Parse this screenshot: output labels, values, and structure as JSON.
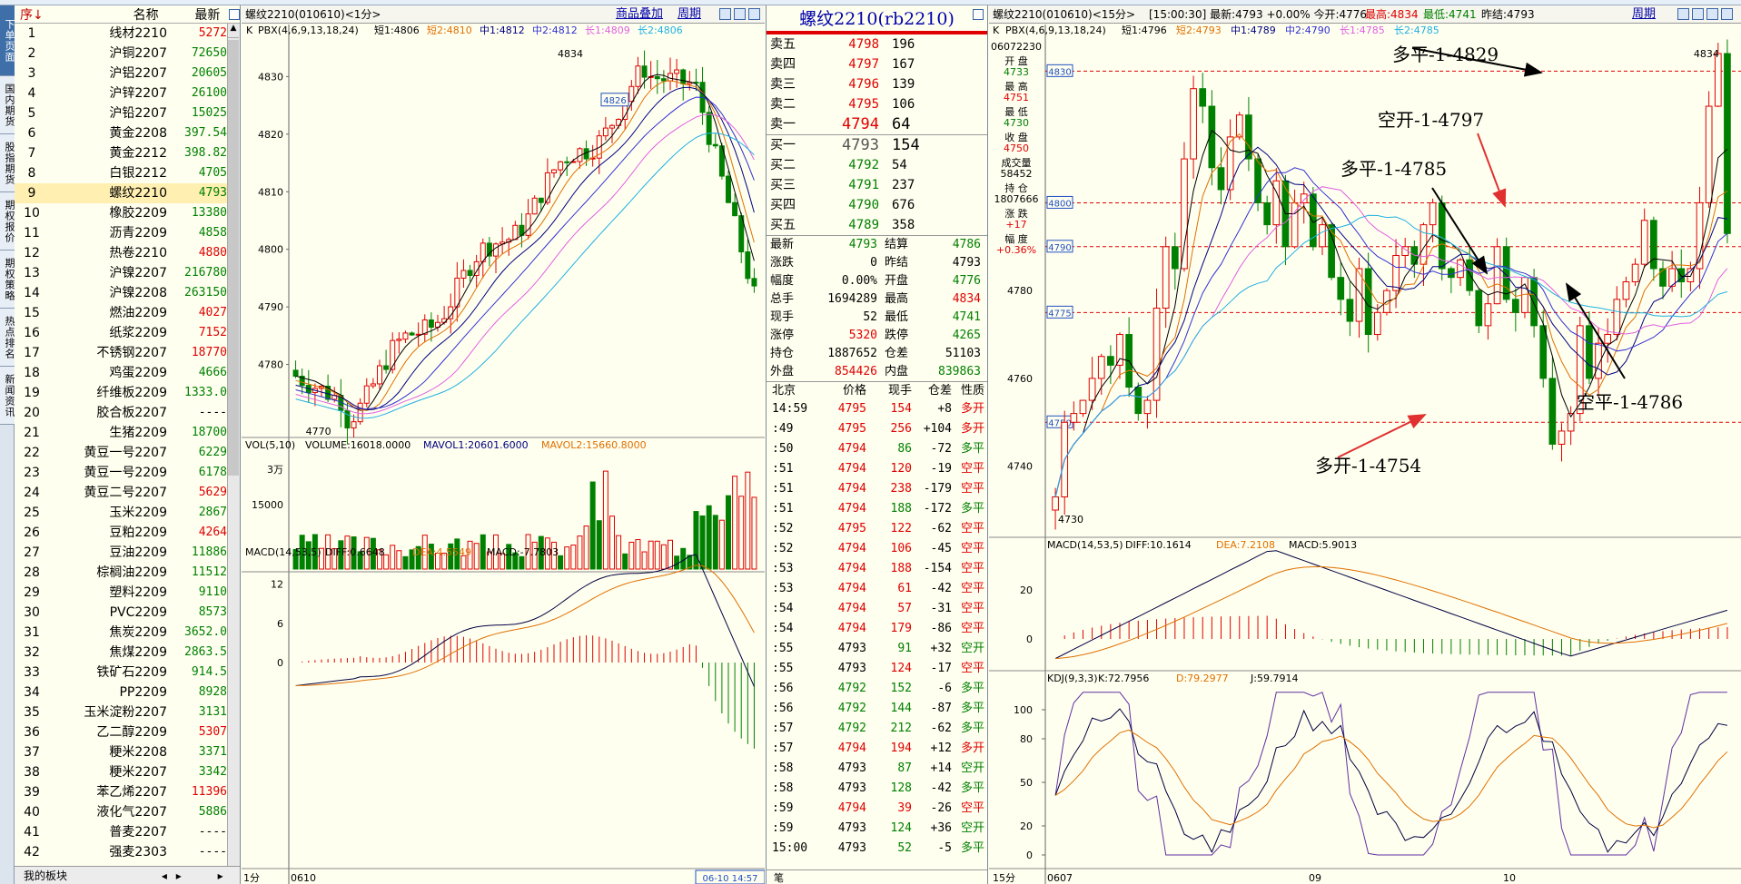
{
  "vertical_tabs": [
    "下单页面",
    "国内期货",
    "股指期货",
    "期权报价",
    "期权策略",
    "热点排名",
    "新闻资讯"
  ],
  "watchlist": {
    "header": {
      "index": "序↓",
      "name": "名称",
      "price": "最新"
    },
    "rows": [
      {
        "i": "1",
        "name": "线材2210",
        "price": "5272",
        "color": "red"
      },
      {
        "i": "2",
        "name": "沪铜2207",
        "price": "72650",
        "color": "green"
      },
      {
        "i": "3",
        "name": "沪铝2207",
        "price": "20605",
        "color": "green"
      },
      {
        "i": "4",
        "name": "沪锌2207",
        "price": "26100",
        "color": "green"
      },
      {
        "i": "5",
        "name": "沪铅2207",
        "price": "15025",
        "color": "green"
      },
      {
        "i": "6",
        "name": "黄金2208",
        "price": "397.54",
        "color": "green"
      },
      {
        "i": "7",
        "name": "黄金2212",
        "price": "398.82",
        "color": "green"
      },
      {
        "i": "8",
        "name": "白银2212",
        "price": "4705",
        "color": "green"
      },
      {
        "i": "9",
        "name": "螺纹2210",
        "price": "4793",
        "color": "green"
      },
      {
        "i": "10",
        "name": "橡胶2209",
        "price": "13380",
        "color": "green"
      },
      {
        "i": "11",
        "name": "沥青2209",
        "price": "4858",
        "color": "green"
      },
      {
        "i": "12",
        "name": "热卷2210",
        "price": "4880",
        "color": "red"
      },
      {
        "i": "13",
        "name": "沪镍2207",
        "price": "216780",
        "color": "green"
      },
      {
        "i": "14",
        "name": "沪镍2208",
        "price": "263150",
        "color": "green"
      },
      {
        "i": "15",
        "name": "燃油2209",
        "price": "4027",
        "color": "red"
      },
      {
        "i": "16",
        "name": "纸浆2209",
        "price": "7152",
        "color": "red"
      },
      {
        "i": "17",
        "name": "不锈钢2207",
        "price": "18770",
        "color": "red"
      },
      {
        "i": "18",
        "name": "鸡蛋2209",
        "price": "4666",
        "color": "green"
      },
      {
        "i": "19",
        "name": "纤维板2209",
        "price": "1333.0",
        "color": "green"
      },
      {
        "i": "20",
        "name": "胶合板2207",
        "price": "----",
        "color": "black"
      },
      {
        "i": "21",
        "name": "生猪2209",
        "price": "18700",
        "color": "green"
      },
      {
        "i": "22",
        "name": "黄豆一号2207",
        "price": "6229",
        "color": "green"
      },
      {
        "i": "23",
        "name": "黄豆一号2209",
        "price": "6178",
        "color": "green"
      },
      {
        "i": "24",
        "name": "黄豆二号2207",
        "price": "5629",
        "color": "red"
      },
      {
        "i": "25",
        "name": "玉米2209",
        "price": "2867",
        "color": "green"
      },
      {
        "i": "26",
        "name": "豆粕2209",
        "price": "4264",
        "color": "red"
      },
      {
        "i": "27",
        "name": "豆油2209",
        "price": "11886",
        "color": "green"
      },
      {
        "i": "28",
        "name": "棕榈油2209",
        "price": "11512",
        "color": "green"
      },
      {
        "i": "29",
        "name": "塑料2209",
        "price": "9110",
        "color": "green"
      },
      {
        "i": "30",
        "name": "PVC2209",
        "price": "8573",
        "color": "green"
      },
      {
        "i": "31",
        "name": "焦炭2209",
        "price": "3652.0",
        "color": "green"
      },
      {
        "i": "32",
        "name": "焦煤2209",
        "price": "2863.5",
        "color": "green"
      },
      {
        "i": "33",
        "name": "铁矿石2209",
        "price": "914.5",
        "color": "green"
      },
      {
        "i": "34",
        "name": "PP2209",
        "price": "8928",
        "color": "green"
      },
      {
        "i": "35",
        "name": "玉米淀粉2207",
        "price": "3131",
        "color": "green"
      },
      {
        "i": "36",
        "name": "乙二醇2209",
        "price": "5307",
        "color": "red"
      },
      {
        "i": "37",
        "name": "粳米2208",
        "price": "3371",
        "color": "green"
      },
      {
        "i": "38",
        "name": "粳米2207",
        "price": "3342",
        "color": "green"
      },
      {
        "i": "39",
        "name": "苯乙烯2207",
        "price": "11396",
        "color": "red"
      },
      {
        "i": "40",
        "name": "液化气2207",
        "price": "5886",
        "color": "green"
      },
      {
        "i": "41",
        "name": "普麦2207",
        "price": "----",
        "color": "black"
      },
      {
        "i": "42",
        "name": "强麦2303",
        "price": "----",
        "color": "black"
      }
    ],
    "footer": "我的板块"
  },
  "left_chart": {
    "title": "螺纹2210(010610)<1分>",
    "btn_overlay": "商品叠加",
    "btn_period": "周期",
    "k_label": "K",
    "pbx_label": "PBX(4,6,9,13,18,24)",
    "pbx_vals": [
      {
        "t": "短1:4806",
        "c": "#000"
      },
      {
        "t": "短2:4810",
        "c": "#E07000"
      },
      {
        "t": "中1:4812",
        "c": "#000080"
      },
      {
        "t": "中2:4812",
        "c": "#3030D0"
      },
      {
        "t": "长1:4809",
        "c": "#E060E0"
      },
      {
        "t": "长2:4806",
        "c": "#20B0E0"
      }
    ],
    "y_ticks": [
      "4830",
      "4820",
      "4810",
      "4800",
      "4790",
      "4780"
    ],
    "hi_label": "4834",
    "lo_label": "4770",
    "last_label": "4826",
    "vol_label": "VOL(5,10)",
    "vol_vals": "VOLUME:16018.0000",
    "mavol1": "MAVOL1:20601.6000",
    "mavol2": "MAVOL2:15660.8000",
    "vol_ticks": [
      "3万",
      "15000"
    ],
    "macd_label": "MACD(14,53,5)",
    "macd_diff": "DIFF:0.6648",
    "macd_dea": "DEA:4.5549",
    "macd_val": "MACD:-7.7803",
    "macd_ticks": [
      "12",
      "6",
      "0"
    ],
    "x_left": "1分",
    "x_date": "0610",
    "x_time": "06-10 14:57"
  },
  "orderbook": {
    "title": "螺纹2210(rb2210)",
    "asks": [
      {
        "l": "卖五",
        "p": "4798",
        "v": "196"
      },
      {
        "l": "卖四",
        "p": "4797",
        "v": "167"
      },
      {
        "l": "卖三",
        "p": "4796",
        "v": "139"
      },
      {
        "l": "卖二",
        "p": "4795",
        "v": "106"
      },
      {
        "l": "卖一",
        "p": "4794",
        "v": "64"
      }
    ],
    "bids": [
      {
        "l": "买一",
        "p": "4793",
        "v": "154"
      },
      {
        "l": "买二",
        "p": "4792",
        "v": "54"
      },
      {
        "l": "买三",
        "p": "4791",
        "v": "237"
      },
      {
        "l": "买四",
        "p": "4790",
        "v": "676"
      },
      {
        "l": "买五",
        "p": "4789",
        "v": "358"
      }
    ],
    "stats": [
      {
        "a": "最新",
        "b": "4793",
        "bc": "green",
        "c": "结算",
        "d": "4786",
        "dc": "green"
      },
      {
        "a": "涨跌",
        "b": "0",
        "bc": "black",
        "c": "昨结",
        "d": "4793",
        "dc": "black"
      },
      {
        "a": "幅度",
        "b": "0.00%",
        "bc": "black",
        "c": "开盘",
        "d": "4776",
        "dc": "green"
      },
      {
        "a": "总手",
        "b": "1694289",
        "bc": "black",
        "c": "最高",
        "d": "4834",
        "dc": "red"
      },
      {
        "a": "现手",
        "b": "52",
        "bc": "black",
        "c": "最低",
        "d": "4741",
        "dc": "green"
      },
      {
        "a": "涨停",
        "b": "5320",
        "bc": "red",
        "c": "跌停",
        "d": "4265",
        "dc": "green"
      },
      {
        "a": "持仓",
        "b": "1887652",
        "bc": "black",
        "c": "仓差",
        "d": "51103",
        "dc": "black"
      },
      {
        "a": "外盘",
        "b": "854426",
        "bc": "red",
        "c": "内盘",
        "d": "839863",
        "dc": "green"
      }
    ],
    "tick_head": [
      "北京",
      "价格",
      "现手",
      "仓差",
      "性质"
    ],
    "ticks": [
      {
        "t": "14:59",
        "p": "4795",
        "pc": "red",
        "v": "154",
        "vc": "red",
        "o": "+8",
        "n": "多开",
        "nc": "red"
      },
      {
        "t": ":49",
        "p": "4795",
        "pc": "red",
        "v": "256",
        "vc": "red",
        "o": "+104",
        "n": "多开",
        "nc": "red"
      },
      {
        "t": ":50",
        "p": "4794",
        "pc": "red",
        "v": "86",
        "vc": "green",
        "o": "-72",
        "n": "多平",
        "nc": "green"
      },
      {
        "t": ":51",
        "p": "4794",
        "pc": "red",
        "v": "120",
        "vc": "red",
        "o": "-19",
        "n": "空平",
        "nc": "red"
      },
      {
        "t": ":51",
        "p": "4794",
        "pc": "red",
        "v": "238",
        "vc": "red",
        "o": "-179",
        "n": "空平",
        "nc": "red"
      },
      {
        "t": ":51",
        "p": "4794",
        "pc": "red",
        "v": "188",
        "vc": "green",
        "o": "-172",
        "n": "多平",
        "nc": "green"
      },
      {
        "t": ":52",
        "p": "4795",
        "pc": "red",
        "v": "122",
        "vc": "red",
        "o": "-62",
        "n": "空平",
        "nc": "red"
      },
      {
        "t": ":52",
        "p": "4794",
        "pc": "red",
        "v": "106",
        "vc": "red",
        "o": "-45",
        "n": "空平",
        "nc": "red"
      },
      {
        "t": ":53",
        "p": "4794",
        "pc": "red",
        "v": "188",
        "vc": "red",
        "o": "-154",
        "n": "空平",
        "nc": "red"
      },
      {
        "t": ":53",
        "p": "4794",
        "pc": "red",
        "v": "61",
        "vc": "red",
        "o": "-42",
        "n": "空平",
        "nc": "red"
      },
      {
        "t": ":54",
        "p": "4794",
        "pc": "red",
        "v": "57",
        "vc": "red",
        "o": "-31",
        "n": "空平",
        "nc": "red"
      },
      {
        "t": ":54",
        "p": "4794",
        "pc": "red",
        "v": "179",
        "vc": "red",
        "o": "-86",
        "n": "空平",
        "nc": "red"
      },
      {
        "t": ":55",
        "p": "4793",
        "pc": "black",
        "v": "91",
        "vc": "green",
        "o": "+32",
        "n": "空开",
        "nc": "green"
      },
      {
        "t": ":55",
        "p": "4793",
        "pc": "black",
        "v": "124",
        "vc": "red",
        "o": "-17",
        "n": "空平",
        "nc": "red"
      },
      {
        "t": ":56",
        "p": "4792",
        "pc": "green",
        "v": "152",
        "vc": "green",
        "o": "-6",
        "n": "多平",
        "nc": "green"
      },
      {
        "t": ":56",
        "p": "4792",
        "pc": "green",
        "v": "144",
        "vc": "green",
        "o": "-87",
        "n": "多平",
        "nc": "green"
      },
      {
        "t": ":57",
        "p": "4792",
        "pc": "green",
        "v": "212",
        "vc": "green",
        "o": "-62",
        "n": "多平",
        "nc": "green"
      },
      {
        "t": ":57",
        "p": "4794",
        "pc": "red",
        "v": "194",
        "vc": "red",
        "o": "+12",
        "n": "多开",
        "nc": "red"
      },
      {
        "t": ":58",
        "p": "4793",
        "pc": "black",
        "v": "87",
        "vc": "green",
        "o": "+14",
        "n": "空开",
        "nc": "green"
      },
      {
        "t": ":58",
        "p": "4793",
        "pc": "black",
        "v": "128",
        "vc": "green",
        "o": "-42",
        "n": "多平",
        "nc": "green"
      },
      {
        "t": ":59",
        "p": "4794",
        "pc": "red",
        "v": "39",
        "vc": "red",
        "o": "-26",
        "n": "空平",
        "nc": "red"
      },
      {
        "t": ":59",
        "p": "4793",
        "pc": "black",
        "v": "124",
        "vc": "green",
        "o": "+36",
        "n": "空开",
        "nc": "green"
      },
      {
        "t": "15:00",
        "p": "4793",
        "pc": "black",
        "v": "52",
        "vc": "green",
        "o": "-5",
        "n": "多平",
        "nc": "green"
      }
    ],
    "foot": "笔"
  },
  "right_chart": {
    "title": "螺纹2210(010610)<15分>",
    "info": "[15:00:30] 最新:4793 +0.00% 今开:4776",
    "info_hi": "最高:4834",
    "info_lo": "最低:4741",
    "info_prev": "昨结:4793",
    "btn_period": "周期",
    "k_label": "K",
    "pbx_label": "PBX(4,6,9,13,18,24)",
    "pbx_vals": [
      {
        "t": "短1:4796",
        "c": "#000"
      },
      {
        "t": "短2:4793",
        "c": "#E07000"
      },
      {
        "t": "中1:4789",
        "c": "#000080"
      },
      {
        "t": "中2:4790",
        "c": "#3030D0"
      },
      {
        "t": "长1:4785",
        "c": "#E060E0"
      },
      {
        "t": "长2:4785",
        "c": "#20B0E0"
      }
    ],
    "info_panel": [
      {
        "t": "06072230",
        "c": "#000"
      },
      {
        "t": "开 盘",
        "c": "#000"
      },
      {
        "t": "4733",
        "c": "#008000"
      },
      {
        "t": "最 高",
        "c": "#000"
      },
      {
        "t": "4751",
        "c": "#E00000"
      },
      {
        "t": "最 低",
        "c": "#000"
      },
      {
        "t": "4730",
        "c": "#008000"
      },
      {
        "t": "收 盘",
        "c": "#000"
      },
      {
        "t": "4750",
        "c": "#E00000"
      },
      {
        "t": "成交量",
        "c": "#000"
      },
      {
        "t": "58452",
        "c": "#000"
      },
      {
        "t": "持 仓",
        "c": "#000"
      },
      {
        "t": "1807666",
        "c": "#000"
      },
      {
        "t": "涨 跌",
        "c": "#000"
      },
      {
        "t": "+17",
        "c": "#E00000"
      },
      {
        "t": "幅 度",
        "c": "#000"
      },
      {
        "t": "+0.36%",
        "c": "#E00000"
      }
    ],
    "y_ticks": [
      "4780",
      "4760",
      "4740"
    ],
    "boxed_levels": [
      "4830",
      "4800",
      "4790",
      "4775",
      "4750"
    ],
    "hi_label": "4834",
    "lo_label": "4730",
    "annotations": [
      {
        "text": "多平-1-4829"
      },
      {
        "text": "空开-1-4797"
      },
      {
        "text": "多平-1-4785"
      },
      {
        "text": "空平-1-4786"
      },
      {
        "text": "多开-1-4754"
      }
    ],
    "macd_label": "MACD(14,53,5)",
    "macd_diff": "DIFF:10.1614",
    "macd_dea": "DEA:7.2108",
    "macd_val": "MACD:5.9013",
    "macd_ticks": [
      "20",
      "0"
    ],
    "kdj_label": "KDJ(9,3,3)",
    "kdj_k": "K:72.7956",
    "kdj_d": "D:79.2977",
    "kdj_j": "J:59.7914",
    "kdj_ticks": [
      "100",
      "80",
      "50",
      "20",
      "0"
    ],
    "x_left": "15分",
    "x_date": "0607",
    "x_mid1": "09",
    "x_mid2": "10"
  }
}
